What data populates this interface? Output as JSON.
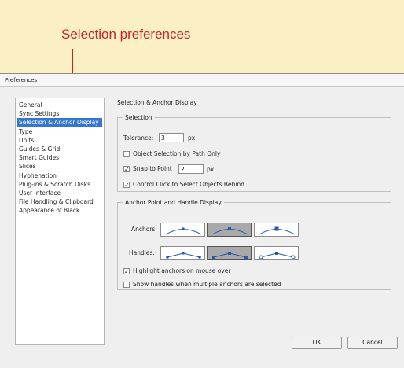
{
  "callout": {
    "text": "Selection preferences"
  },
  "window": {
    "title": "Preferences"
  },
  "sidebar": {
    "items": [
      {
        "label": "General"
      },
      {
        "label": "Sync Settings"
      },
      {
        "label": "Selection & Anchor Display"
      },
      {
        "label": "Type"
      },
      {
        "label": "Units"
      },
      {
        "label": "Guides & Grid"
      },
      {
        "label": "Smart Guides"
      },
      {
        "label": "Slices"
      },
      {
        "label": "Hyphenation"
      },
      {
        "label": "Plug-ins & Scratch Disks"
      },
      {
        "label": "User Interface"
      },
      {
        "label": "File Handling & Clipboard"
      },
      {
        "label": "Appearance of Black"
      }
    ],
    "selected": "Selection & Anchor Display"
  },
  "content": {
    "title": "Selection & Anchor Display",
    "selection": {
      "legend": "Selection",
      "tolerance_label": "Tolerance:",
      "tolerance_value": "3",
      "tolerance_unit": "px",
      "object_by_path_label": "Object Selection by Path Only",
      "object_by_path_checked": false,
      "snap_label": "Snap to Point",
      "snap_checked": true,
      "snap_value": "2",
      "snap_unit": "px",
      "control_click_label": "Control Click to Select Objects Behind",
      "control_click_checked": true
    },
    "anchor": {
      "legend": "Anchor Point and Handle Display",
      "anchors_label": "Anchors:",
      "handles_label": "Handles:",
      "anchors_selected_index": 1,
      "handles_selected_index": 1,
      "highlight_label": "Highlight anchors on mouse over",
      "highlight_checked": true,
      "show_handles_label": "Show handles when multiple anchors are selected",
      "show_handles_checked": false
    }
  },
  "buttons": {
    "ok": "OK",
    "cancel": "Cancel"
  },
  "colors": {
    "callout": "#cc2027",
    "selection": "#3477d1",
    "curve": "#2a57b0"
  }
}
